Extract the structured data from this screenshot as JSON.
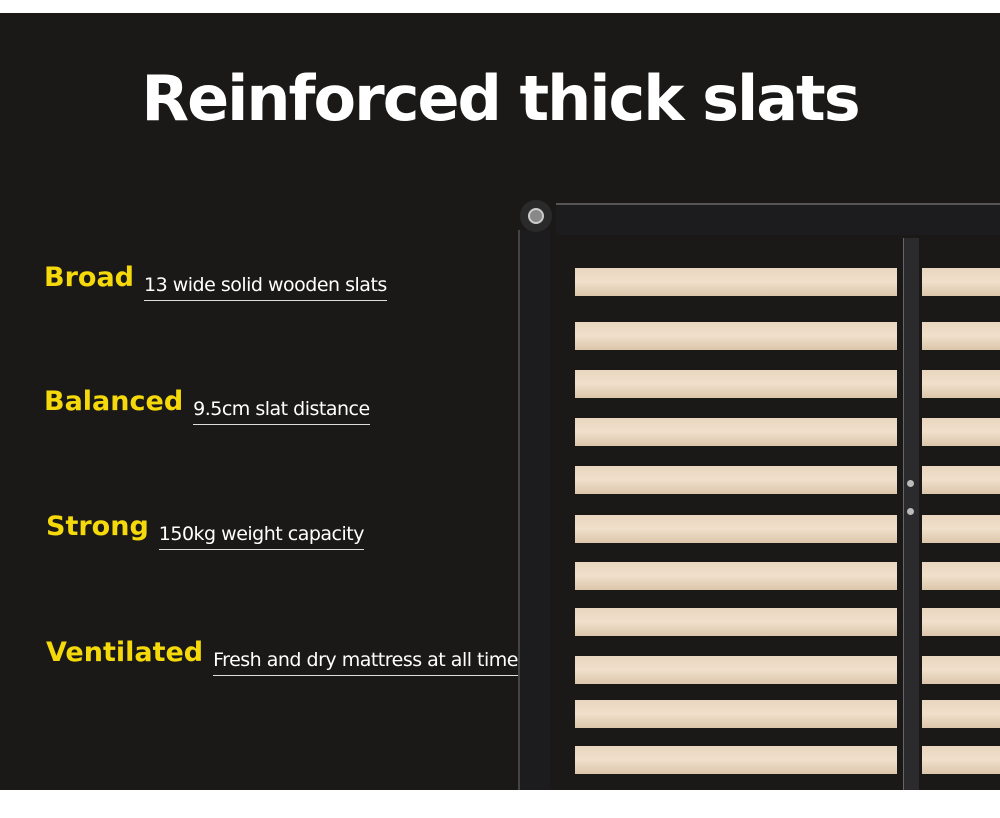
{
  "title": "Reinforced thick slats",
  "features": [
    {
      "key": "Broad",
      "value": "13 wide solid wooden slats"
    },
    {
      "key": "Balanced",
      "value": "9.5cm slat distance"
    },
    {
      "key": "Strong",
      "value": "150kg weight capacity"
    },
    {
      "key": "Ventilated",
      "value": "Fresh and dry mattress at all times"
    }
  ],
  "colors": {
    "background": "#1a1918",
    "accent": "#f5d90a",
    "text": "#ffffff",
    "slat": "#ecdac4"
  }
}
